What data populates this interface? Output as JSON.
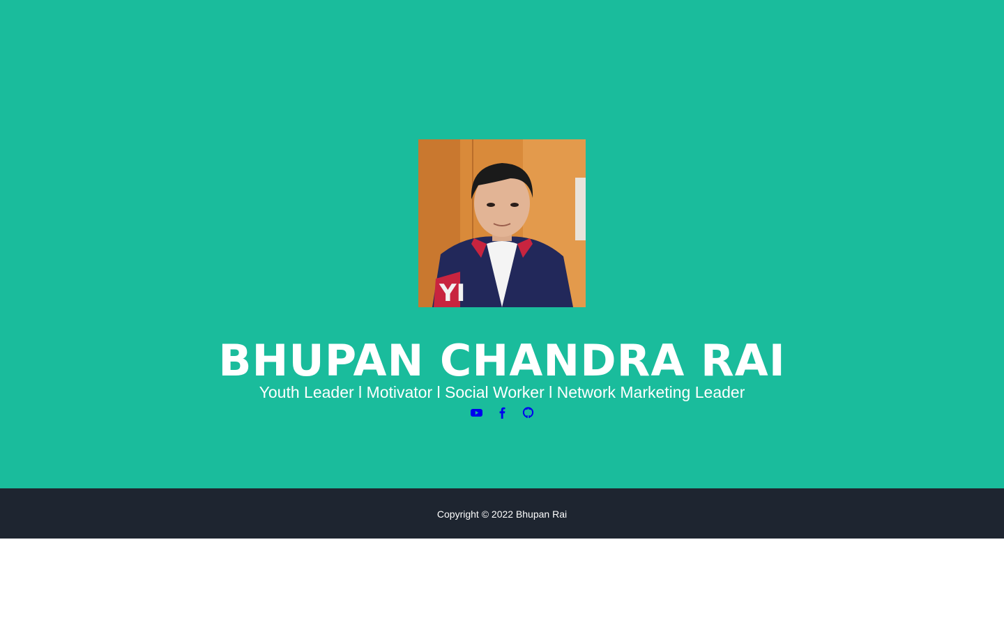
{
  "profile": {
    "avatar_alt": "profile photo",
    "name": "BHUPAN CHANDRA RAI",
    "tagline": "Youth Leader l Motivator l Social Worker l Network Marketing Leader"
  },
  "social": [
    {
      "icon": "youtube-icon"
    },
    {
      "icon": "facebook-icon"
    },
    {
      "icon": "github-icon"
    }
  ],
  "footer": {
    "copyright": "Copyright © 2022 Bhupan Rai"
  },
  "colors": {
    "masthead_bg": "#1abc9c",
    "footer_bg": "#1e2530",
    "link": "#0000ee",
    "text": "#ffffff"
  }
}
